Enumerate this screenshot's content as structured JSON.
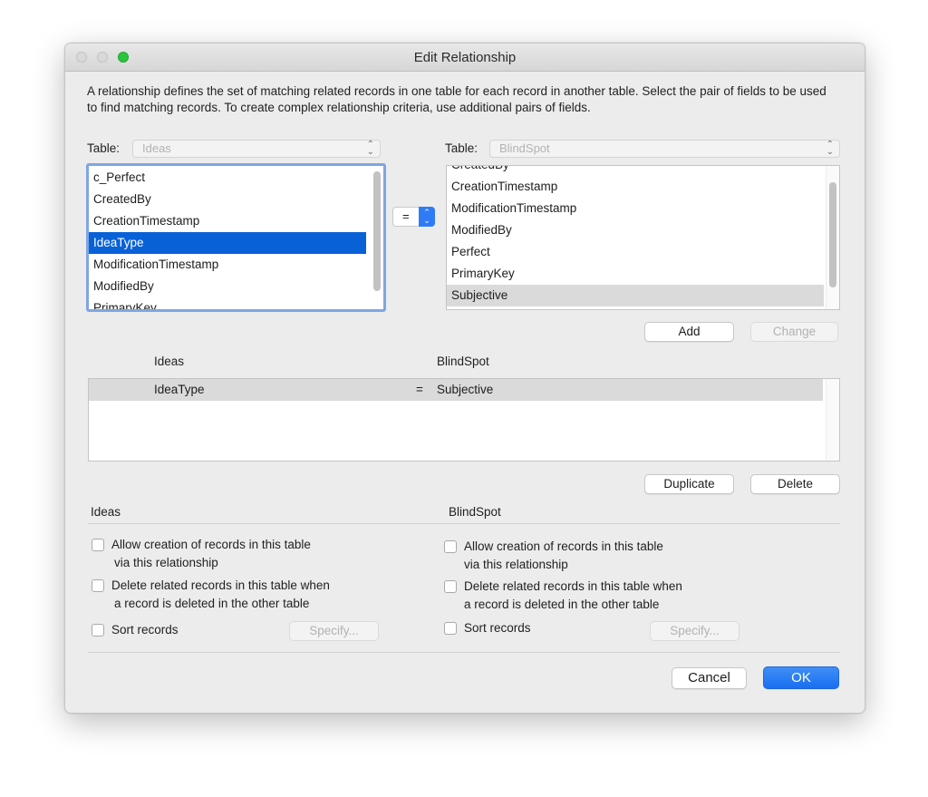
{
  "window": {
    "title": "Edit Relationship"
  },
  "description": "A relationship defines the set of matching related records in one table for each record in another table. Select the pair of fields to be used to find matching records. To create complex relationship criteria, use additional pairs of fields.",
  "left_table": {
    "label": "Table:",
    "value": "Ideas",
    "fields": [
      "c_Perfect",
      "CreatedBy",
      "CreationTimestamp",
      "IdeaType",
      "ModificationTimestamp",
      "ModifiedBy",
      "PrimaryKey"
    ],
    "selected": "IdeaType"
  },
  "operator": {
    "value": "="
  },
  "right_table": {
    "label": "Table:",
    "value": "BlindSpot",
    "fields": [
      "CreatedBy",
      "CreationTimestamp",
      "ModificationTimestamp",
      "ModifiedBy",
      "Perfect",
      "PrimaryKey",
      "Subjective"
    ],
    "selected": "Subjective"
  },
  "buttons": {
    "add": "Add",
    "change": "Change",
    "duplicate": "Duplicate",
    "delete": "Delete",
    "cancel": "Cancel",
    "ok": "OK",
    "specify": "Specify..."
  },
  "criteria": {
    "left_header": "Ideas",
    "right_header": "BlindSpot",
    "rows": [
      {
        "left": "IdeaType",
        "op": "=",
        "right": "Subjective"
      }
    ]
  },
  "options": {
    "left": {
      "header": "Ideas",
      "allow_creation": "Allow creation of records in this table",
      "allow_creation_2": "via this relationship",
      "delete_related": "Delete related records in this table when",
      "delete_related_2": "a record is deleted in the other table",
      "sort": "Sort records"
    },
    "right": {
      "header": "BlindSpot",
      "allow_creation": "Allow creation of records in this table",
      "allow_creation_2": "via this relationship",
      "delete_related": "Delete related records in this table when",
      "delete_related_2": "a record is deleted in the other table",
      "sort": "Sort records"
    }
  },
  "colors": {
    "accent": "#0961d8",
    "primary_button": "#1a6ef0",
    "zoom": "#2ac43f"
  }
}
